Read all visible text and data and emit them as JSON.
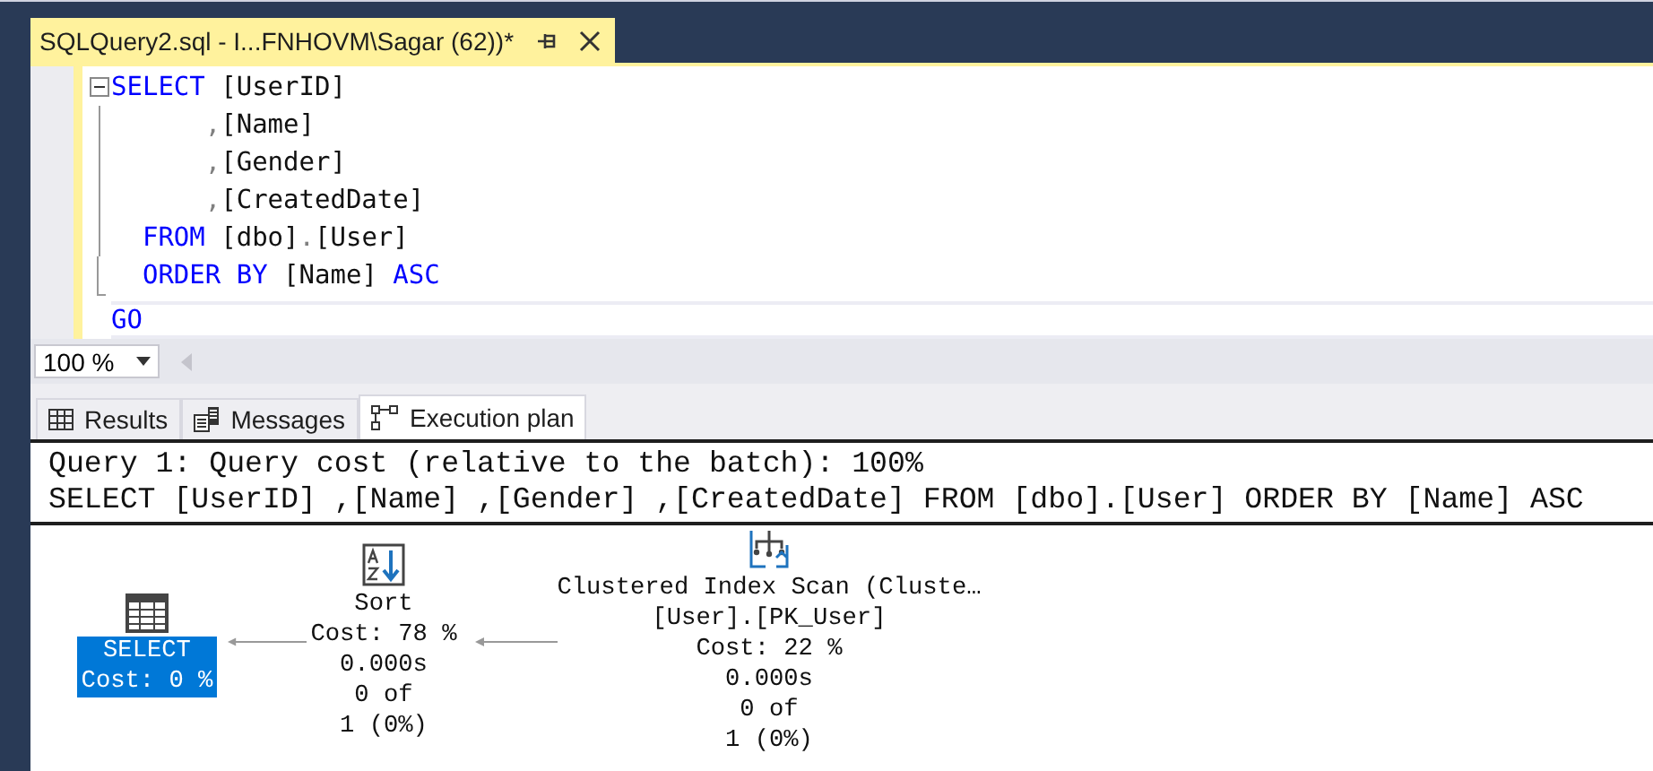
{
  "document_tab": {
    "title": "SQLQuery2.sql - I...FNHOVM\\Sagar (62))*"
  },
  "editor": {
    "lines": [
      {
        "tokens": [
          {
            "text": "SELECT",
            "kind": "keyword"
          },
          {
            "text": " [UserID]",
            "kind": "ident"
          }
        ],
        "kind": "fold_start"
      },
      {
        "tokens": [
          {
            "text": "      ,",
            "kind": "punct"
          },
          {
            "text": "[Name]",
            "kind": "ident"
          }
        ],
        "kind": "fold_inside"
      },
      {
        "tokens": [
          {
            "text": "      ,",
            "kind": "punct"
          },
          {
            "text": "[Gender]",
            "kind": "ident"
          }
        ],
        "kind": "fold_inside"
      },
      {
        "tokens": [
          {
            "text": "      ,",
            "kind": "punct"
          },
          {
            "text": "[CreatedDate]",
            "kind": "ident"
          }
        ],
        "kind": "fold_inside"
      },
      {
        "tokens": [
          {
            "text": "  FROM",
            "kind": "keyword"
          },
          {
            "text": " [dbo]",
            "kind": "ident"
          },
          {
            "text": ".",
            "kind": "punct"
          },
          {
            "text": "[User]",
            "kind": "ident"
          }
        ],
        "kind": "fold_inside"
      },
      {
        "tokens": [
          {
            "text": "  ORDER BY",
            "kind": "keyword"
          },
          {
            "text": " [Name] ",
            "kind": "ident"
          },
          {
            "text": "ASC",
            "kind": "keyword"
          }
        ],
        "kind": "fold_end"
      },
      {
        "tokens": [
          {
            "text": "GO",
            "kind": "keyword"
          }
        ],
        "kind": "plain",
        "current": true
      }
    ]
  },
  "zoom": {
    "value": "100 %"
  },
  "result_tabs": [
    {
      "label": "Results",
      "selected": false
    },
    {
      "label": "Messages",
      "selected": false
    },
    {
      "label": "Execution plan",
      "selected": true
    }
  ],
  "plan": {
    "header": [
      "Query 1: Query cost (relative to the batch): 100%",
      "SELECT [UserID] ,[Name] ,[Gender] ,[CreatedDate] FROM [dbo].[User] ORDER BY [Name] ASC"
    ],
    "nodes": [
      {
        "kind": "select",
        "lines": [
          "SELECT",
          "Cost: 0 %"
        ],
        "selected": true
      },
      {
        "kind": "sort",
        "lines": [
          "Sort",
          "Cost: 78 %",
          "0.000s",
          "0 of",
          "1 (0%)"
        ],
        "selected": false
      },
      {
        "kind": "scan",
        "lines": [
          "Clustered Index Scan (Cluste…",
          "[User].[PK_User]",
          "Cost: 22 %",
          "0.000s",
          "0 of",
          "1 (0%)"
        ],
        "selected": false
      }
    ]
  }
}
